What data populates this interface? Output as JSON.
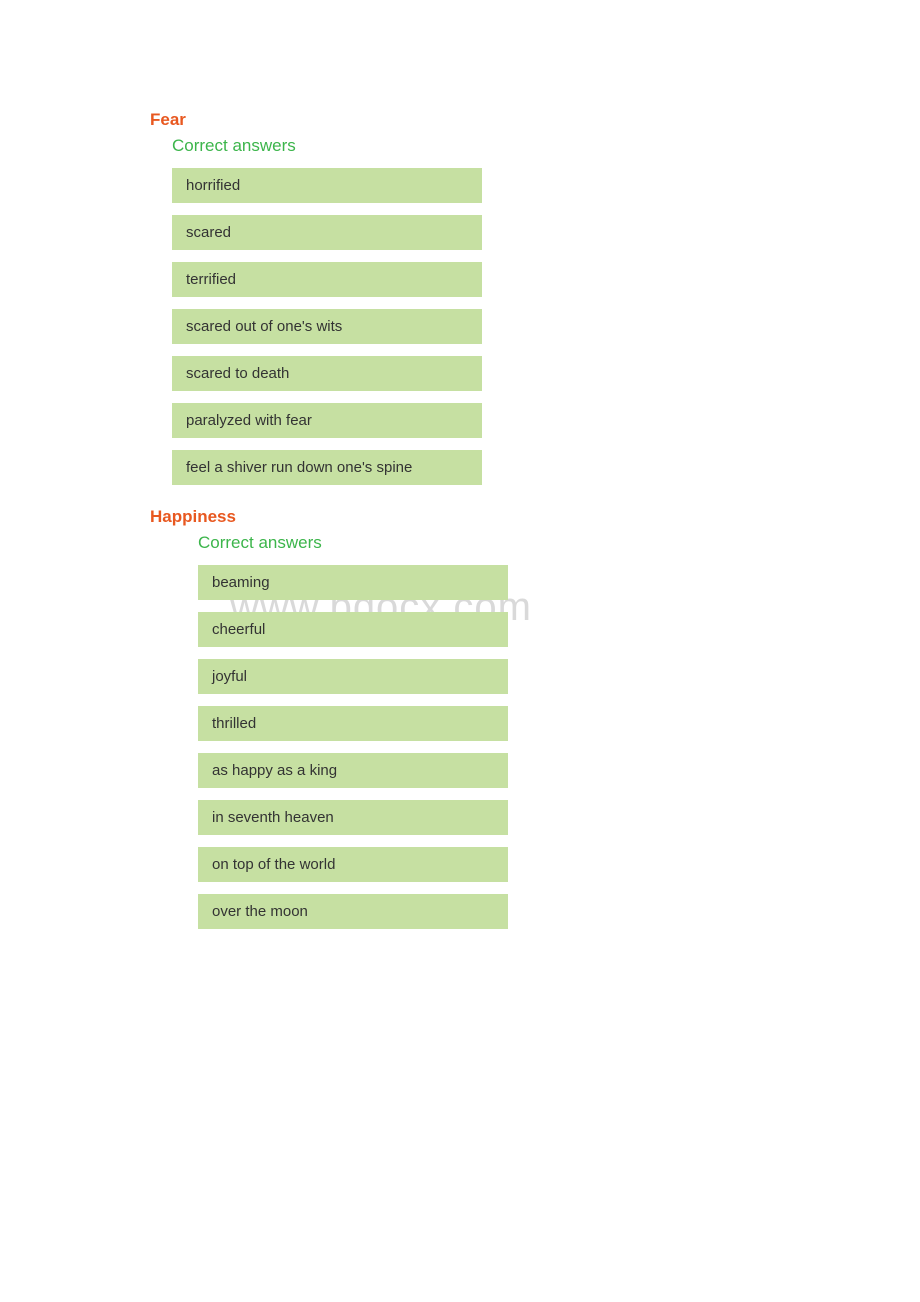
{
  "watermark": "www.bdocx.com",
  "sections": [
    {
      "title": "Fear",
      "subhead": "Correct answers",
      "answers": [
        "horrified",
        "scared",
        "terrified",
        "scared out of one's wits",
        "scared to death",
        "paralyzed with fear",
        "feel a shiver run down one's spine"
      ]
    },
    {
      "title": "Happiness",
      "subhead": "Correct answers",
      "answers": [
        "beaming",
        "cheerful",
        "joyful",
        "thrilled",
        "as happy as a king",
        "in seventh heaven",
        "on top of the world",
        "over the moon"
      ]
    }
  ]
}
